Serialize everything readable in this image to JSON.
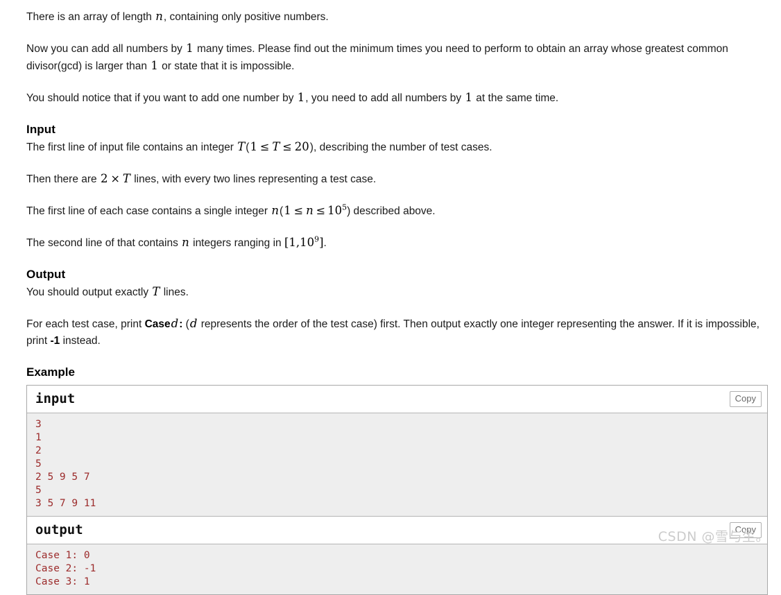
{
  "intro": {
    "line1_a": "There is an array of length ",
    "line1_n": "n",
    "line1_b": ", containing only positive numbers.",
    "line2_a": "Now you can add all numbers by ",
    "line2_one": "1",
    "line2_b": " many times. Please find out the minimum times you need to perform to obtain an array whose greatest common divisor(gcd) is larger than ",
    "line2_one2": "1",
    "line2_c": " or state that it is impossible.",
    "line3_a": "You should notice that if you want to add one number by ",
    "line3_one": "1",
    "line3_b": ", you need to add all numbers by ",
    "line3_one2": "1",
    "line3_c": " at the same time."
  },
  "input": {
    "heading": "Input",
    "p1_a": "The first line of input file contains an integer ",
    "p1_T": "T",
    "p1_paren_open": "(",
    "p1_one": "1",
    "p1_le1": "≤",
    "p1_T2": "T",
    "p1_le2": "≤",
    "p1_twenty": "20",
    "p1_paren_close": ")",
    "p1_b": ", describing the number of test cases.",
    "p2_a": "Then there are ",
    "p2_two": "2",
    "p2_times": "×",
    "p2_T": "T",
    "p2_b": " lines, with every two lines representing a test case.",
    "p3_a": "The first line of each case contains a single integer ",
    "p3_n": "n",
    "p3_paren_open": "(",
    "p3_one": "1",
    "p3_le1": "≤",
    "p3_n2": "n",
    "p3_le2": "≤",
    "p3_pow_base": "10",
    "p3_pow_exp": "5",
    "p3_paren_close": ")",
    "p3_b": " described above.",
    "p4_a": "The second line of that contains ",
    "p4_n": "n",
    "p4_b": " integers ranging in ",
    "p4_range_open": "[",
    "p4_one": "1,",
    "p4_pow_base": "10",
    "p4_pow_exp": "9",
    "p4_range_close": "]",
    "p4_c": "."
  },
  "output": {
    "heading": "Output",
    "p1_a": "You should output exactly ",
    "p1_T": "T",
    "p1_b": " lines.",
    "p2_a": "For each test case, print ",
    "p2_case": "Case",
    "p2_d": "d",
    "p2_colon": ":",
    "p2_b": " (",
    "p2_d2": "d",
    "p2_c": " represents the order of the test case) first. Then output exactly one integer representing the answer. If it is impossible, print ",
    "p2_minus1": "-1",
    "p2_d3": " instead."
  },
  "example": {
    "heading": "Example",
    "blocks": [
      {
        "title": "input",
        "copy_label": "Copy",
        "content": "3\n1\n2\n5\n2 5 9 5 7\n5\n3 5 7 9 11"
      },
      {
        "title": "output",
        "copy_label": "Copy",
        "content": "Case 1: 0\nCase 2: -1\nCase 3: 1"
      }
    ]
  },
  "watermark": {
    "text": "CSDN @雪与生。"
  },
  "colors": {
    "code_text": "#9c2b2b",
    "code_bg": "#eeeeee",
    "border": "#a8a8a8",
    "body_text": "#1b1b1b",
    "watermark": "#cccccc"
  }
}
